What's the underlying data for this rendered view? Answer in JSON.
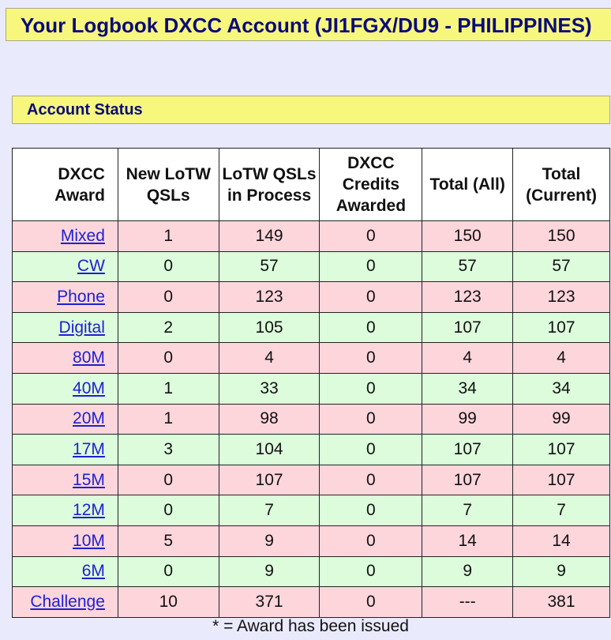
{
  "header": {
    "title": "Your Logbook DXCC Account (JI1FGX/DU9 - PHILIPPINES)"
  },
  "section": {
    "title": "Account Status"
  },
  "table": {
    "columns": [
      "DXCC Award",
      "New LoTW QSLs",
      "LoTW QSLs in Process",
      "DXCC Credits Awarded",
      "Total (All)",
      "Total (Current)"
    ],
    "rows": [
      {
        "award": "Mixed",
        "new": "1",
        "in_process": "149",
        "credits": "0",
        "total_all": "150",
        "total_current": "150"
      },
      {
        "award": "CW",
        "new": "0",
        "in_process": "57",
        "credits": "0",
        "total_all": "57",
        "total_current": "57"
      },
      {
        "award": "Phone",
        "new": "0",
        "in_process": "123",
        "credits": "0",
        "total_all": "123",
        "total_current": "123"
      },
      {
        "award": "Digital",
        "new": "2",
        "in_process": "105",
        "credits": "0",
        "total_all": "107",
        "total_current": "107"
      },
      {
        "award": "80M",
        "new": "0",
        "in_process": "4",
        "credits": "0",
        "total_all": "4",
        "total_current": "4"
      },
      {
        "award": "40M",
        "new": "1",
        "in_process": "33",
        "credits": "0",
        "total_all": "34",
        "total_current": "34"
      },
      {
        "award": "20M",
        "new": "1",
        "in_process": "98",
        "credits": "0",
        "total_all": "99",
        "total_current": "99"
      },
      {
        "award": "17M",
        "new": "3",
        "in_process": "104",
        "credits": "0",
        "total_all": "107",
        "total_current": "107"
      },
      {
        "award": "15M",
        "new": "0",
        "in_process": "107",
        "credits": "0",
        "total_all": "107",
        "total_current": "107"
      },
      {
        "award": "12M",
        "new": "0",
        "in_process": "7",
        "credits": "0",
        "total_all": "7",
        "total_current": "7"
      },
      {
        "award": "10M",
        "new": "5",
        "in_process": "9",
        "credits": "0",
        "total_all": "14",
        "total_current": "14"
      },
      {
        "award": "6M",
        "new": "0",
        "in_process": "9",
        "credits": "0",
        "total_all": "9",
        "total_current": "9"
      },
      {
        "award": "Challenge",
        "new": "10",
        "in_process": "371",
        "credits": "0",
        "total_all": "---",
        "total_current": "381"
      }
    ]
  },
  "footnote": "* = Award has been issued",
  "colors": {
    "banner": "#f7f77e",
    "banner_text": "#0b0b7a",
    "row_pink": "#fdd6dc",
    "row_green": "#dcfcdc",
    "link": "#1f1fd1",
    "page_bg": "#e9eafc"
  }
}
